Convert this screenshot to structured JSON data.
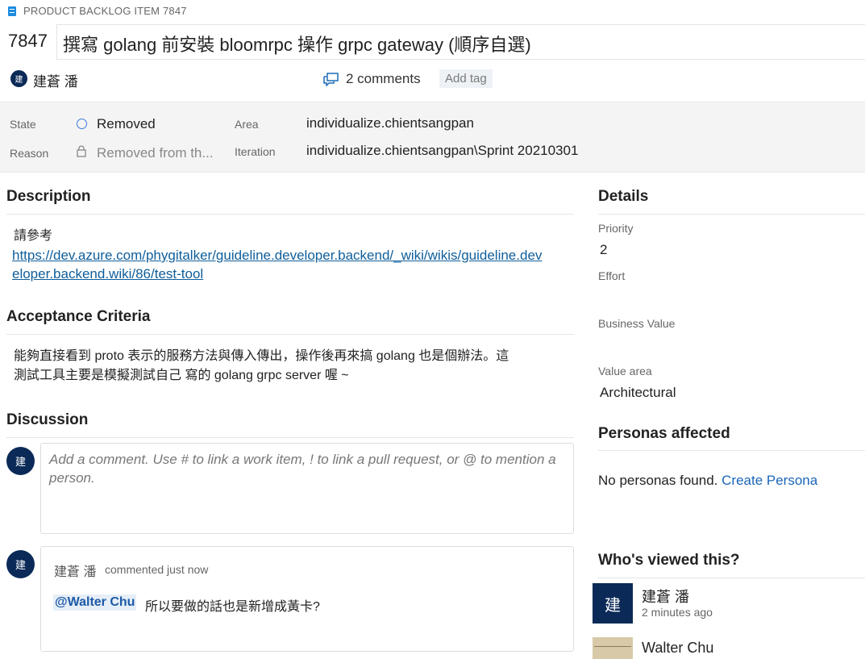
{
  "header": {
    "type_label": "PRODUCT BACKLOG ITEM 7847",
    "id": "7847",
    "title": "撰寫 golang 前安裝 bloomrpc 操作 grpc gateway (順序自選)",
    "owner_initial": "建",
    "owner_name": "建蒼 潘",
    "comments_label": "2 comments",
    "add_tag_label": "Add tag"
  },
  "fields": {
    "state_label": "State",
    "state_value": "Removed",
    "reason_label": "Reason",
    "reason_value": "Removed from th...",
    "area_label": "Area",
    "area_value": "individualize.chientsangpan",
    "iteration_label": "Iteration",
    "iteration_value": "individualize.chientsangpan\\Sprint 20210301"
  },
  "description": {
    "title": "Description",
    "text": "請參考",
    "link_line1": "https://dev.azure.com/phygitalker/guideline.developer.backend/_wiki/wikis/guideline.dev",
    "link_line2": "eloper.backend.wiki/86/test-tool"
  },
  "acceptance": {
    "title": "Acceptance Criteria",
    "line1": "能夠直接看到 proto 表示的服務方法與傳入傳出，操作後再來搞 golang 也是個辦法。這",
    "line2": "測試工具主要是模擬測試自己 寫的 golang grpc server 喔 ~"
  },
  "discussion": {
    "title": "Discussion",
    "user_initial": "建",
    "placeholder": "Add a comment. Use # to link a work item, ! to link a pull request, or @ to mention a person.",
    "comment": {
      "author_initial": "建",
      "author": "建蒼 潘",
      "when": "commented just now",
      "mention": "@Walter Chu",
      "text": "所以要做的話也是新增成黃卡?"
    }
  },
  "details": {
    "title": "Details",
    "priority_label": "Priority",
    "priority_value": "2",
    "effort_label": "Effort",
    "business_value_label": "Business Value",
    "value_area_label": "Value area",
    "value_area_value": "Architectural"
  },
  "personas": {
    "title": "Personas affected",
    "empty_text": "No personas found.",
    "create_link": "Create Persona"
  },
  "viewers": {
    "title": "Who's viewed this?",
    "items": [
      {
        "initial": "建",
        "name": "建蒼 潘",
        "time": "2 minutes ago"
      },
      {
        "name": "Walter Chu"
      }
    ]
  },
  "colors": {
    "accent": "#0f5e9b",
    "avatar_bg": "#0b2a57",
    "band_bg": "#f4f4f4",
    "state_circle": "#3c7ad8"
  }
}
